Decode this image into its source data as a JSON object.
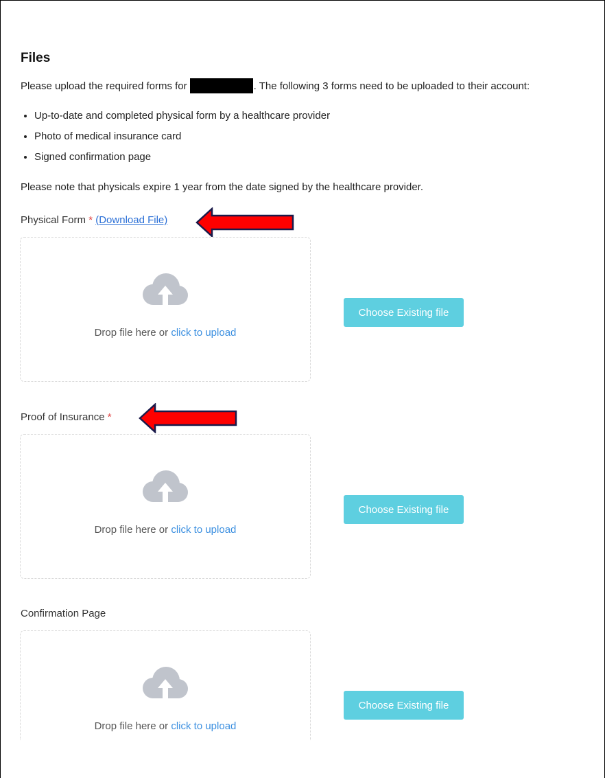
{
  "files": {
    "heading": "Files",
    "intro_before": "Please upload the required forms for",
    "intro_after": ". The following 3 forms need to be uploaded to their account:",
    "bullets": [
      "Up-to-date and completed physical form by a healthcare provider",
      "Photo of medical insurance card",
      "Signed confirmation page"
    ],
    "note": "Please note that physicals expire 1 year from the date signed by the healthcare provider."
  },
  "uploads": [
    {
      "label": "Physical Form",
      "required_mark": "*",
      "download_link": "(Download File)",
      "drop_text": "Drop file here or",
      "click_text": "click to upload",
      "button_label": "Choose Existing file"
    },
    {
      "label": "Proof of Insurance",
      "required_mark": "*",
      "drop_text": "Drop file here or",
      "click_text": "click to upload",
      "button_label": "Choose Existing file"
    },
    {
      "label": "Confirmation Page",
      "drop_text": "Drop file here or",
      "click_text": "click to upload",
      "button_label": "Choose Existing file"
    }
  ],
  "colors": {
    "required": "#e04545",
    "link": "#2a6fd6",
    "upload_link": "#3b8fe0",
    "button_bg": "#5ecfe0",
    "cloud": "#c0c4cc",
    "annotation_arrow": "#ff0000"
  },
  "icons": {
    "upload": "cloud-upload-icon",
    "annotation": "red-arrow-annotation"
  }
}
